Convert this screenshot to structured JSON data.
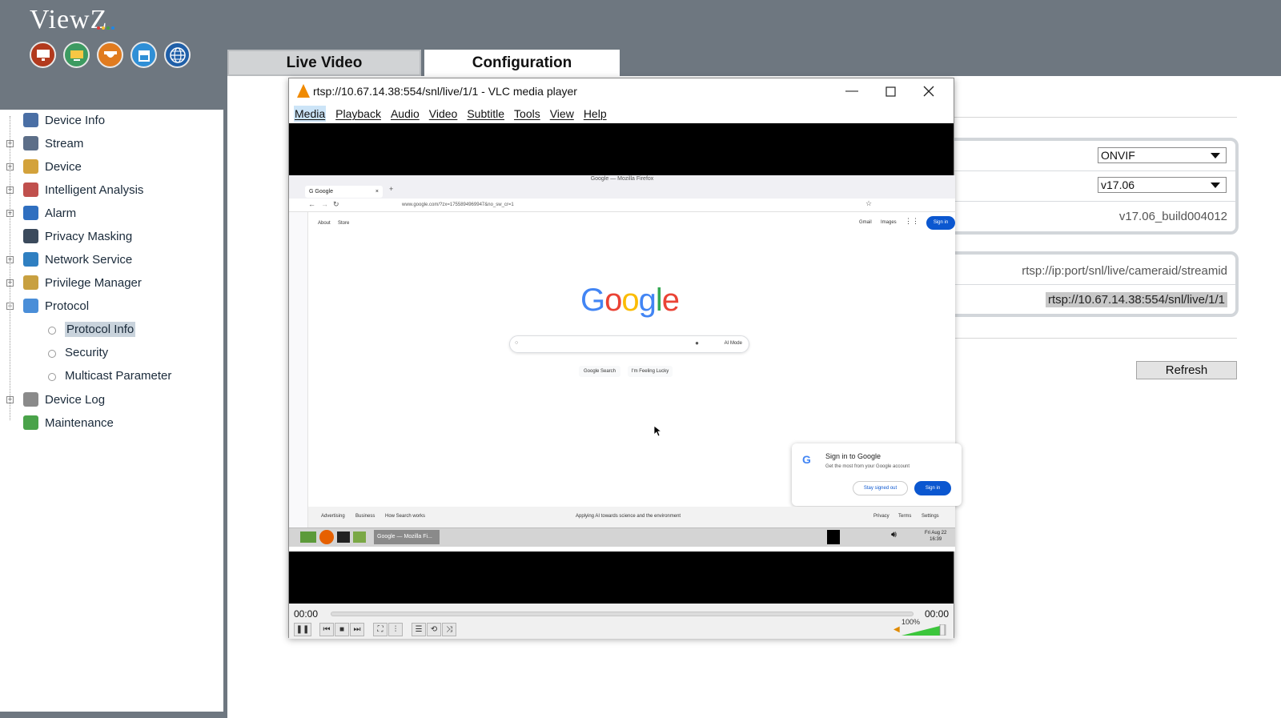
{
  "app": {
    "logo_text": "ViewZ",
    "colors": {
      "header": "#6e7780",
      "vlc_cone": "#f08a00",
      "google_blue": "#0b57d0"
    },
    "header_icons": [
      "monitor-icon",
      "display-icon",
      "camera-dome-icon",
      "storefront-icon",
      "globe-icon"
    ]
  },
  "tabs": {
    "live": "Live Video",
    "config": "Configuration"
  },
  "sidebar": {
    "items": [
      {
        "label": "Device Info",
        "icon": "document-icon",
        "expandable": false
      },
      {
        "label": "Stream",
        "icon": "stream-icon",
        "expandable": true
      },
      {
        "label": "Device",
        "icon": "device-icon",
        "expandable": true
      },
      {
        "label": "Intelligent Analysis",
        "icon": "analysis-icon",
        "expandable": true
      },
      {
        "label": "Alarm",
        "icon": "alarm-icon",
        "expandable": true
      },
      {
        "label": "Privacy Masking",
        "icon": "privacy-icon",
        "expandable": false
      },
      {
        "label": "Network Service",
        "icon": "network-icon",
        "expandable": true
      },
      {
        "label": "Privilege Manager",
        "icon": "users-icon",
        "expandable": true
      },
      {
        "label": "Protocol",
        "icon": "protocol-icon",
        "expandable": true,
        "expanded": true
      },
      {
        "label": "Device Log",
        "icon": "log-icon",
        "expandable": true
      },
      {
        "label": "Maintenance",
        "icon": "maintenance-icon",
        "expandable": false
      }
    ],
    "protocol_children": [
      {
        "label": "Protocol Info",
        "selected": true
      },
      {
        "label": "Security",
        "selected": false
      },
      {
        "label": "Multicast Parameter",
        "selected": false
      }
    ]
  },
  "config": {
    "protocol_select": "ONVIF",
    "version_select": "v17.06",
    "build": "v17.06_build004012",
    "rtsp_format": "rtsp://ip:port/snl/live/cameraid/streamid",
    "rtsp_url": "rtsp://10.67.14.38:554/snl/live/1/1",
    "refresh_label": "Refresh"
  },
  "vlc": {
    "title": "rtsp://10.67.14.38:554/snl/live/1/1 - VLC media player",
    "menu": [
      "Media",
      "Playback",
      "Audio",
      "Video",
      "Subtitle",
      "Tools",
      "View",
      "Help"
    ],
    "time_elapsed": "00:00",
    "time_total": "00:00",
    "volume": "100%",
    "volume_level": 1.0
  },
  "firefox": {
    "window_title": "Google — Mozilla Firefox",
    "tab_label": "Google",
    "url": "www.google.com/?zx=1755894969947&no_sw_cr=1",
    "top_links": [
      "About",
      "Store"
    ],
    "right_links": [
      "Gmail",
      "Images"
    ],
    "sign_in": "Sign in",
    "logo": "Google",
    "ai_mode": "AI Mode",
    "btn_search": "Google Search",
    "btn_lucky": "I'm Feeling Lucky",
    "popup_title": "Sign in to Google",
    "popup_sub": "Get the most from your Google account",
    "popup_stay": "Stay signed out",
    "popup_signin": "Sign in",
    "footer_left": [
      "Advertising",
      "Business",
      "How Search works"
    ],
    "footer_center": "Applying AI towards science and the environment",
    "footer_right": [
      "Privacy",
      "Terms",
      "Settings"
    ],
    "taskbar_task": "Google — Mozilla Fi...",
    "taskbar_date": "Fri Aug 22",
    "taskbar_time": "16:39"
  }
}
